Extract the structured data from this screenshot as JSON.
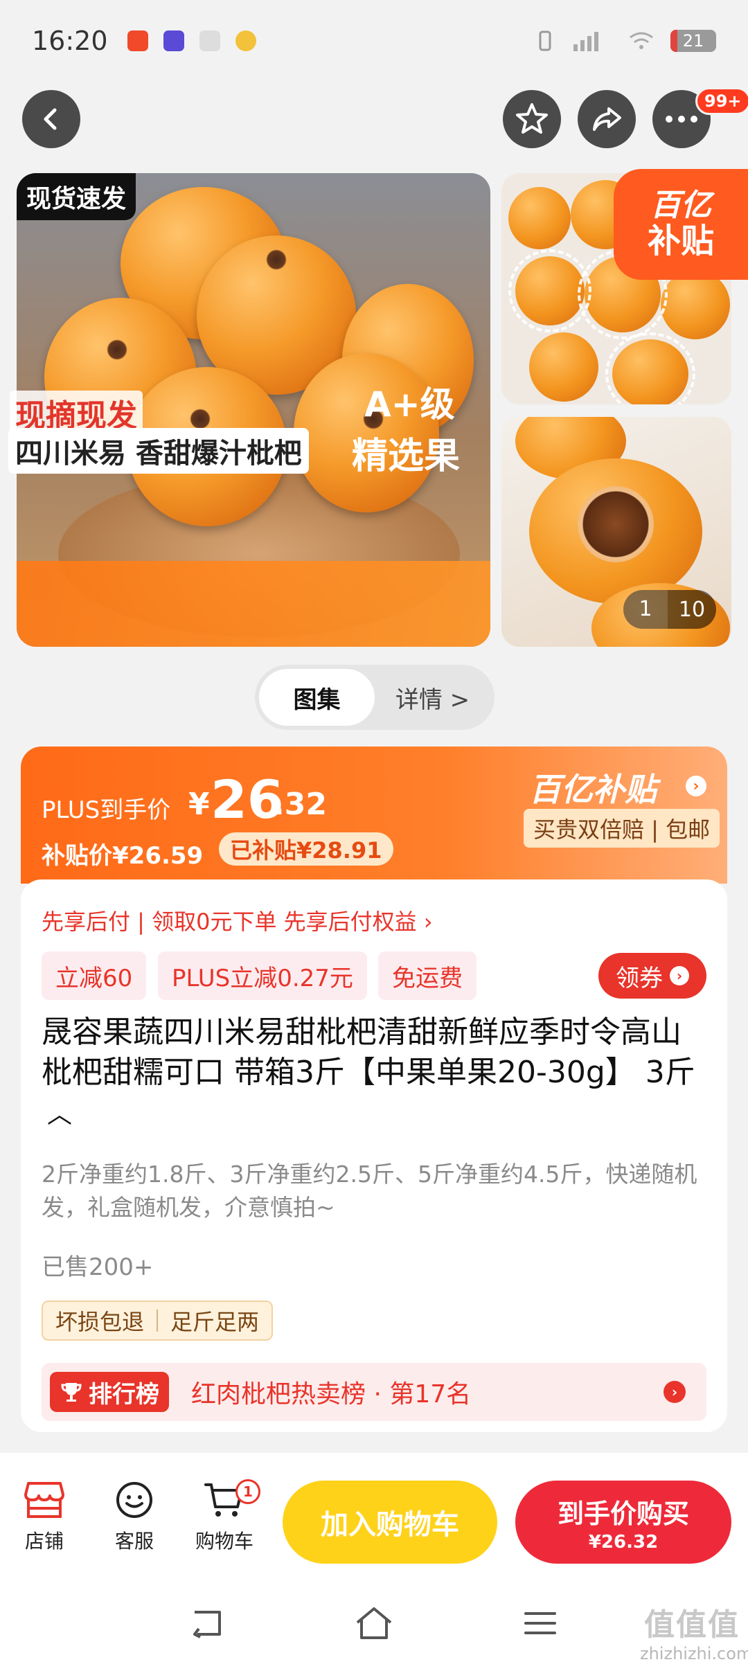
{
  "status_bar": {
    "time": "16:20",
    "battery": "21"
  },
  "top_nav": {
    "badge": "99+"
  },
  "gallery": {
    "tag_top": "现货速发",
    "tag_fresh": "现摘现发",
    "tag_origin": "四川米易 香甜爆汁枇杷",
    "tag_grade": "A+级",
    "tag_select": "精选果",
    "subsidy_line1": "百亿",
    "subsidy_line2": "补贴",
    "counter_current": "1",
    "counter_total": "10"
  },
  "tabs": {
    "gallery": "图集",
    "details": "详情 >"
  },
  "price": {
    "plus_label": "PLUS到手价",
    "symbol": "¥",
    "integer": "26",
    "decimal": ".32",
    "subsidy_price": "补贴价¥26.59",
    "subsidized": "已补贴¥28.91",
    "brand": "百亿补贴",
    "brand_tags": "买贵双倍赔 | 包邮"
  },
  "info": {
    "pay_later": "先享后付 | 领取0元下单 先享后付权益 ›",
    "promo_1": "立减60",
    "promo_2": "PLUS立减0.27元",
    "promo_3": "免运费",
    "coupon": "领券",
    "title": "晟容果蔬四川米易甜枇杷清甜新鲜应季时令高山枇杷甜糯可口 带箱3斤【中果单果20-30g】 3斤",
    "description": "2斤净重约1.8斤、3斤净重约2.5斤、5斤净重约4.5斤，快递随机发，礼盒随机发，介意慎拍~",
    "sold": "已售200+",
    "guarantee_1": "坏损包退",
    "guarantee_2": "足斤足两",
    "rank_tag": "排行榜",
    "rank_text": "红肉枇杷热卖榜 · 第17名"
  },
  "action_bar": {
    "store": "店铺",
    "service": "客服",
    "cart": "购物车",
    "cart_count": "1",
    "add_to_cart": "加入购物车",
    "buy_now": "到手价购买",
    "buy_now_price": "¥26.32"
  },
  "watermark": {
    "logo": "值值值",
    "domain": "zhizhizhi.com"
  },
  "colors": {
    "accent_orange": "#ff6a17",
    "accent_red": "#e8342a",
    "cart_yellow": "#ffd21a"
  }
}
